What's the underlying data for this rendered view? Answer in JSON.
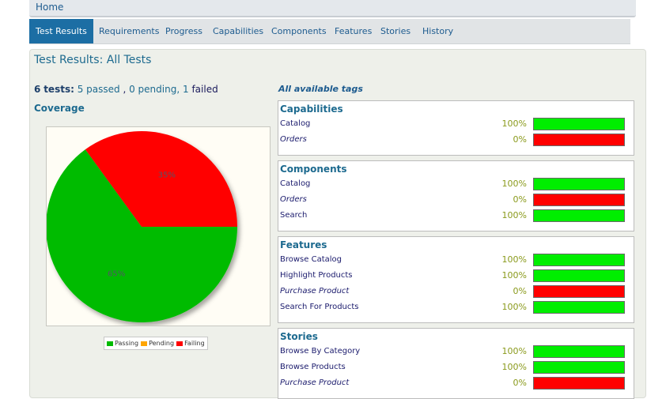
{
  "topbar": {
    "home": "Home"
  },
  "tabs": [
    {
      "label": "Test Results",
      "active": true
    },
    {
      "label": "Requirements",
      "active": false
    },
    {
      "label": "Progress",
      "active": false
    },
    {
      "label": "Capabilities",
      "active": false
    },
    {
      "label": "Components",
      "active": false
    },
    {
      "label": "Features",
      "active": false
    },
    {
      "label": "Stories",
      "active": false
    },
    {
      "label": "History",
      "active": false
    }
  ],
  "page": {
    "title": "Test Results: All Tests"
  },
  "summary": {
    "count": "6",
    "tests_label": "tests:",
    "passed": "5 passed",
    "pending": "0 pending,",
    "failed_count": "1",
    "failed_label": "failed"
  },
  "coverage": {
    "title": "Coverage"
  },
  "chart_data": {
    "type": "pie",
    "slices": [
      {
        "label": "Passing",
        "value": 65,
        "color": "#00bb00",
        "text": "65%"
      },
      {
        "label": "Pending",
        "value": 0,
        "color": "#ffa500",
        "text": ""
      },
      {
        "label": "Failing",
        "value": 35,
        "color": "#ff0000",
        "text": "35%"
      }
    ],
    "legend": [
      "Passing",
      "Pending",
      "Failing"
    ],
    "legend_position": "bottom"
  },
  "tags": {
    "heading": "All available tags",
    "colors": {
      "pass": "#00ee00",
      "fail": "#ff0000"
    },
    "groups": [
      {
        "title": "Capabilities",
        "rows": [
          {
            "name": "Catalog",
            "pct": "100%",
            "status": "pass"
          },
          {
            "name": "Orders",
            "pct": "0%",
            "status": "fail"
          }
        ]
      },
      {
        "title": "Components",
        "rows": [
          {
            "name": "Catalog",
            "pct": "100%",
            "status": "pass"
          },
          {
            "name": "Orders",
            "pct": "0%",
            "status": "fail"
          },
          {
            "name": "Search",
            "pct": "100%",
            "status": "pass"
          }
        ]
      },
      {
        "title": "Features",
        "rows": [
          {
            "name": "Browse Catalog",
            "pct": "100%",
            "status": "pass"
          },
          {
            "name": "Highlight Products",
            "pct": "100%",
            "status": "pass"
          },
          {
            "name": "Purchase Product",
            "pct": "0%",
            "status": "fail"
          },
          {
            "name": "Search For Products",
            "pct": "100%",
            "status": "pass"
          }
        ]
      },
      {
        "title": "Stories",
        "rows": [
          {
            "name": "Browse By Category",
            "pct": "100%",
            "status": "pass"
          },
          {
            "name": "Browse Products",
            "pct": "100%",
            "status": "pass"
          },
          {
            "name": "Purchase Product",
            "pct": "0%",
            "status": "fail"
          }
        ]
      }
    ]
  }
}
